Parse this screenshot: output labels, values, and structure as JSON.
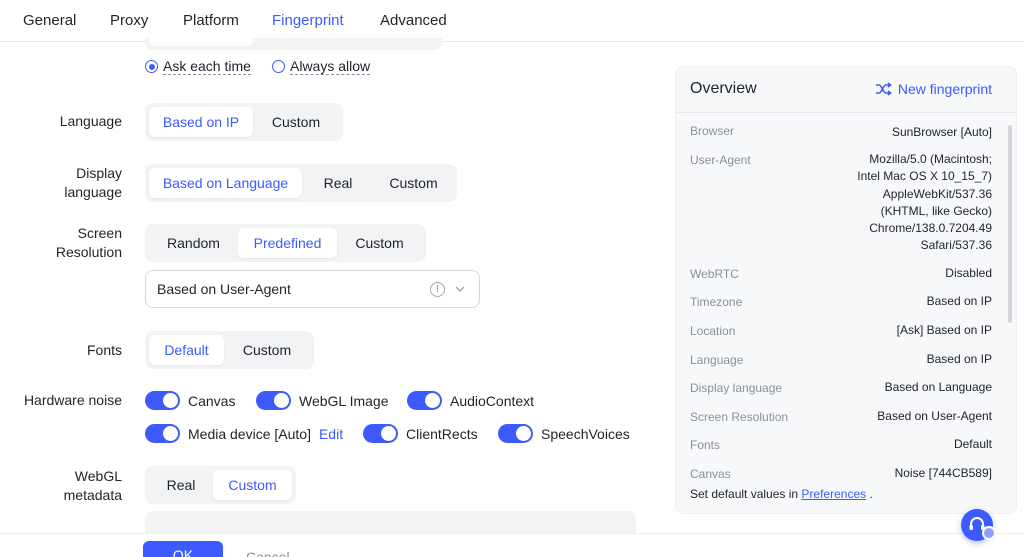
{
  "tabs": [
    {
      "label": "General"
    },
    {
      "label": "Proxy"
    },
    {
      "label": "Platform"
    },
    {
      "label": "Fingerprint"
    },
    {
      "label": "Advanced"
    }
  ],
  "active_tab": "Fingerprint",
  "permission": {
    "options": [
      "Ask each time",
      "Always allow"
    ],
    "selected": "Ask each time"
  },
  "language": {
    "label": "Language",
    "options": [
      "Based on IP",
      "Custom"
    ],
    "selected": "Based on IP"
  },
  "display_language": {
    "label_line1": "Display",
    "label_line2": "language",
    "options": [
      "Based on Language",
      "Real",
      "Custom"
    ],
    "selected": "Based on Language"
  },
  "screen_resolution": {
    "label_line1": "Screen",
    "label_line2": "Resolution",
    "options": [
      "Random",
      "Predefined",
      "Custom"
    ],
    "selected": "Predefined",
    "select_value": "Based on User-Agent"
  },
  "fonts": {
    "label": "Fonts",
    "options": [
      "Default",
      "Custom"
    ],
    "selected": "Default"
  },
  "hardware_noise": {
    "label": "Hardware noise",
    "items": [
      {
        "label": "Canvas",
        "on": true
      },
      {
        "label": "WebGL Image",
        "on": true
      },
      {
        "label": "AudioContext",
        "on": true
      },
      {
        "label": "Media device [Auto]",
        "on": true
      },
      {
        "label": "ClientRects",
        "on": true
      },
      {
        "label": "SpeechVoices",
        "on": true
      }
    ],
    "edit_label": "Edit"
  },
  "webgl_metadata": {
    "label_line1": "WebGL",
    "label_line2": "metadata",
    "options": [
      "Real",
      "Custom"
    ],
    "selected": "Custom"
  },
  "footer": {
    "ok_label": "OK",
    "cancel_label": "Cancel"
  },
  "overview": {
    "title": "Overview",
    "new_fingerprint_label": "New fingerprint",
    "rows": [
      {
        "key": "Browser",
        "value": [
          "SunBrowser [Auto]"
        ]
      },
      {
        "key": "User-Agent",
        "value": [
          "Mozilla/5.0 (Macintosh;",
          "Intel Mac OS X 10_15_7)",
          "AppleWebKit/537.36",
          "(KHTML, like Gecko)",
          "Chrome/138.0.7204.49",
          "Safari/537.36"
        ]
      },
      {
        "key": "WebRTC",
        "value": [
          "Disabled"
        ]
      },
      {
        "key": "Timezone",
        "value": [
          "Based on IP"
        ]
      },
      {
        "key": "Location",
        "value": [
          "[Ask] Based on IP"
        ]
      },
      {
        "key": "Language",
        "value": [
          "Based on IP"
        ]
      },
      {
        "key": "Display language",
        "value": [
          "Based on Language"
        ]
      },
      {
        "key": "Screen Resolution",
        "value": [
          "Based on User-Agent"
        ]
      },
      {
        "key": "Fonts",
        "value": [
          "Default"
        ]
      },
      {
        "key": "Canvas",
        "value": [
          "Noise [744CB589]"
        ]
      }
    ],
    "footer_text": "Set default values in",
    "footer_link": "Preferences",
    "footer_suffix": "."
  },
  "colors": {
    "accent": "#3d5afe",
    "muted": "#8a8f99",
    "segment_bg": "#f2f3f5"
  }
}
